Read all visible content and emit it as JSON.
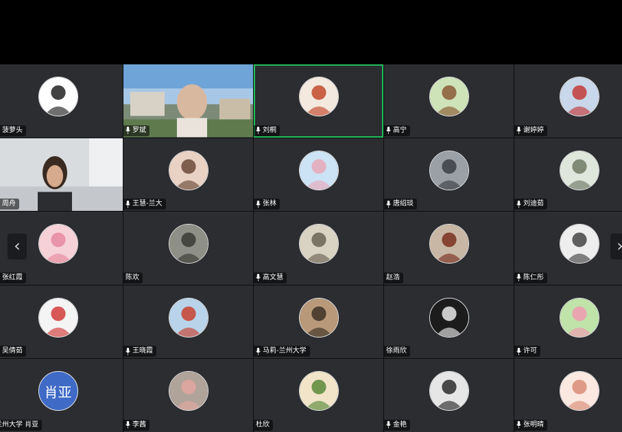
{
  "participants": [
    {
      "name": "菠萝头",
      "mic": true,
      "type": "avatar",
      "color": "#ffffff",
      "accent": "#222222"
    },
    {
      "name": "罗斌",
      "mic": true,
      "type": "video_campus"
    },
    {
      "name": "刘桐",
      "mic": true,
      "type": "avatar",
      "color": "#f3e9df",
      "accent": "#c24a2b",
      "active": true
    },
    {
      "name": "高宁",
      "mic": true,
      "type": "avatar",
      "color": "#cfe3b8",
      "accent": "#8a5a36"
    },
    {
      "name": "谢婷婷",
      "mic": true,
      "type": "avatar",
      "color": "#c9d7ea",
      "accent": "#c23b3b"
    },
    {
      "name": "周舟",
      "mic": true,
      "type": "video_room"
    },
    {
      "name": "王慧-兰大",
      "mic": true,
      "type": "avatar",
      "color": "#e9d1c4",
      "accent": "#6b4a38"
    },
    {
      "name": "张林",
      "mic": true,
      "type": "avatar",
      "color": "#cbe3f5",
      "accent": "#e6a9b9"
    },
    {
      "name": "唐绍琰",
      "mic": true,
      "type": "avatar",
      "color": "#9aa0a6",
      "accent": "#3c3f44"
    },
    {
      "name": "刘迪茹",
      "mic": true,
      "type": "avatar",
      "color": "#dfe6dc",
      "accent": "#6f7a65"
    },
    {
      "name": "张红霞",
      "mic": true,
      "type": "avatar",
      "color": "#f6d2d8",
      "accent": "#e68aa0"
    },
    {
      "name": "陈欢",
      "mic": false,
      "type": "avatar",
      "color": "#8e8f86",
      "accent": "#3a3b36"
    },
    {
      "name": "高文慧",
      "mic": true,
      "type": "avatar",
      "color": "#d9d3c3",
      "accent": "#6b6455"
    },
    {
      "name": "赵浩",
      "mic": false,
      "type": "avatar",
      "color": "#c9b7a5",
      "accent": "#7a3020"
    },
    {
      "name": "陈仁彤",
      "mic": true,
      "type": "avatar",
      "color": "#eeeeee",
      "accent": "#444444"
    },
    {
      "name": "吴倩茹",
      "mic": true,
      "type": "avatar",
      "color": "#f4f4f4",
      "accent": "#d23b3b"
    },
    {
      "name": "王晓霞",
      "mic": true,
      "type": "avatar",
      "color": "#b9d4ea",
      "accent": "#c8412f"
    },
    {
      "name": "马莉-兰州大学",
      "mic": true,
      "type": "avatar",
      "color": "#b89a7a",
      "accent": "#3e3127"
    },
    {
      "name": "徐雨欣",
      "mic": false,
      "type": "avatar",
      "color": "#1c1c1c",
      "accent": "#e8e8e8"
    },
    {
      "name": "许可",
      "mic": true,
      "type": "avatar",
      "color": "#bfe3a9",
      "accent": "#f09ab1"
    },
    {
      "name": "兰州大学 肖亚",
      "mic": false,
      "type": "text",
      "text": "肖亚",
      "color": "#3f6ac6"
    },
    {
      "name": "李茜",
      "mic": true,
      "type": "avatar",
      "color": "#b0a39a",
      "accent": "#e2a7a0"
    },
    {
      "name": "杜欣",
      "mic": false,
      "type": "avatar",
      "color": "#f1e4c9",
      "accent": "#5a8a3a"
    },
    {
      "name": "金艳",
      "mic": true,
      "type": "avatar",
      "color": "#e6e6e6",
      "accent": "#2b2b2b"
    },
    {
      "name": "张明晴",
      "mic": true,
      "type": "avatar",
      "color": "#fbe9e1",
      "accent": "#d88c76"
    }
  ],
  "nav": {
    "prev": "‹",
    "next": "›"
  }
}
